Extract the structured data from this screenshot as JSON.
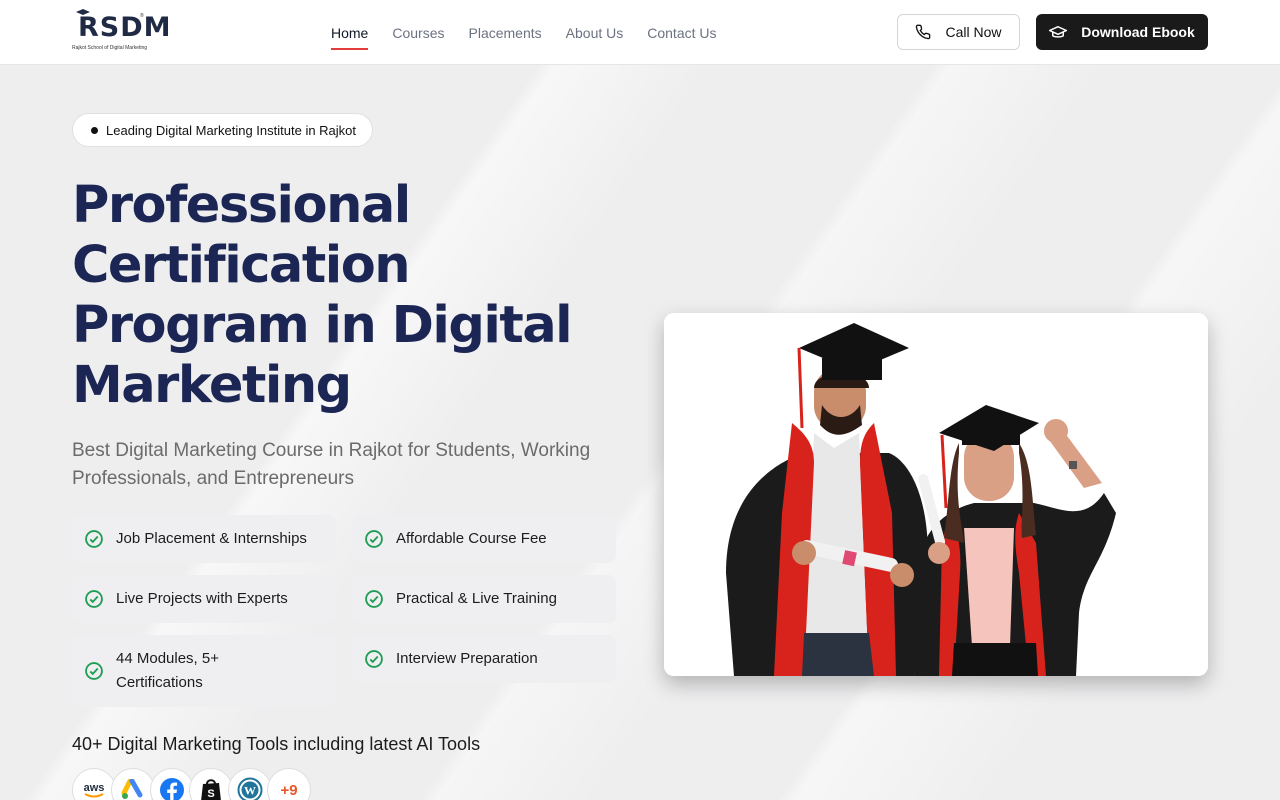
{
  "logo": {
    "text": "RSDM",
    "subtitle": "Rajkot School of Digital Marketing",
    "tm": "®"
  },
  "nav": {
    "items": [
      {
        "label": "Home",
        "active": true
      },
      {
        "label": "Courses",
        "active": false
      },
      {
        "label": "Placements",
        "active": false
      },
      {
        "label": "About Us",
        "active": false
      },
      {
        "label": "Contact Us",
        "active": false
      }
    ]
  },
  "header_actions": {
    "call_label": "Call Now",
    "ebook_label": "Download Ebook"
  },
  "hero": {
    "badge": "Leading Digital Marketing Institute in Rajkot",
    "title": "Professional Certification Program in Digital Marketing",
    "subtitle": "Best Digital Marketing Course in Rajkot for Students, Working Professionals, and Entrepreneurs",
    "features": [
      "Job Placement & Internships",
      "Affordable Course Fee",
      "Live Projects with Experts",
      "Practical & Live Training",
      "44 Modules, 5+ Certifications",
      "Interview Preparation"
    ],
    "tools_heading": "40+ Digital Marketing Tools including latest AI Tools",
    "tools": [
      {
        "icon": "aws-icon",
        "label": "aws"
      },
      {
        "icon": "google-ads-icon",
        "label": ""
      },
      {
        "icon": "facebook-icon",
        "label": ""
      },
      {
        "icon": "shopify-icon",
        "label": ""
      },
      {
        "icon": "wordpress-icon",
        "label": ""
      }
    ],
    "tools_more": "+9"
  },
  "colors": {
    "title": "#1b2654",
    "accent": "#e23c3c",
    "check": "#1f9d55",
    "dark_button": "#1a1a1a"
  }
}
